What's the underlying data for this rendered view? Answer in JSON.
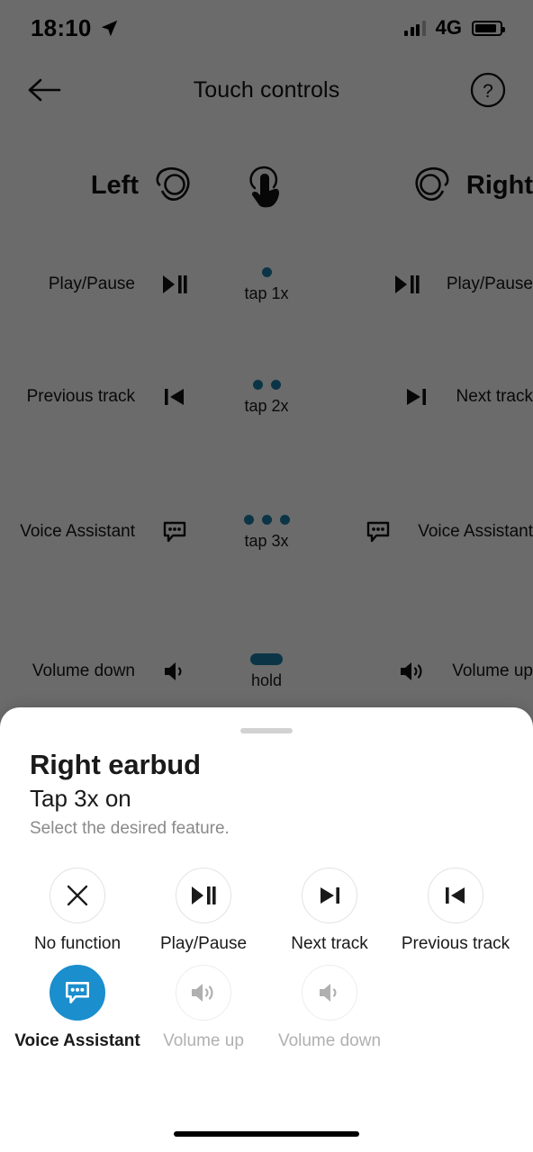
{
  "status_bar": {
    "time": "18:10",
    "location_icon": "location-arrow-icon",
    "signal_icon": "cellular-signal-icon",
    "network": "4G",
    "battery_icon": "battery-icon"
  },
  "header": {
    "back_icon": "back-arrow-icon",
    "title": "Touch controls",
    "help_icon": "help-circle-icon"
  },
  "touch_controls": {
    "left_label": "Left",
    "right_label": "Right",
    "left_earbud_icon": "earbud-icon",
    "right_earbud_icon": "earbud-icon",
    "tap_gesture_icon": "tap-hand-icon",
    "accent_color": "#1b7fa8",
    "rows": [
      {
        "gesture": "tap 1x",
        "dots": 1,
        "left_label": "Play/Pause",
        "left_icon": "play-pause-icon",
        "right_label": "Play/Pause",
        "right_icon": "play-pause-icon"
      },
      {
        "gesture": "tap 2x",
        "dots": 2,
        "left_label": "Previous track",
        "left_icon": "previous-track-icon",
        "right_label": "Next track",
        "right_icon": "next-track-icon"
      },
      {
        "gesture": "tap 3x",
        "dots": 3,
        "left_label": "Voice Assistant",
        "left_icon": "voice-assistant-icon",
        "right_label": "Voice Assistant",
        "right_icon": "voice-assistant-icon"
      },
      {
        "gesture": "hold",
        "dots": 0,
        "left_label": "Volume down",
        "left_icon": "volume-down-icon",
        "right_label": "Volume up",
        "right_icon": "volume-up-icon"
      }
    ]
  },
  "sheet": {
    "title": "Right earbud",
    "subtitle": "Tap 3x on",
    "hint": "Select the desired feature.",
    "selected_color": "#1b8ecd",
    "options": [
      {
        "label": "No function",
        "icon": "close-x-icon",
        "state": "enabled"
      },
      {
        "label": "Play/Pause",
        "icon": "play-pause-icon",
        "state": "enabled"
      },
      {
        "label": "Next track",
        "icon": "next-track-icon",
        "state": "enabled"
      },
      {
        "label": "Previous track",
        "icon": "previous-track-icon",
        "state": "enabled"
      },
      {
        "label": "Voice Assistant",
        "icon": "voice-assistant-icon",
        "state": "selected"
      },
      {
        "label": "Volume up",
        "icon": "volume-up-icon",
        "state": "disabled"
      },
      {
        "label": "Volume down",
        "icon": "volume-down-icon",
        "state": "disabled"
      }
    ]
  }
}
